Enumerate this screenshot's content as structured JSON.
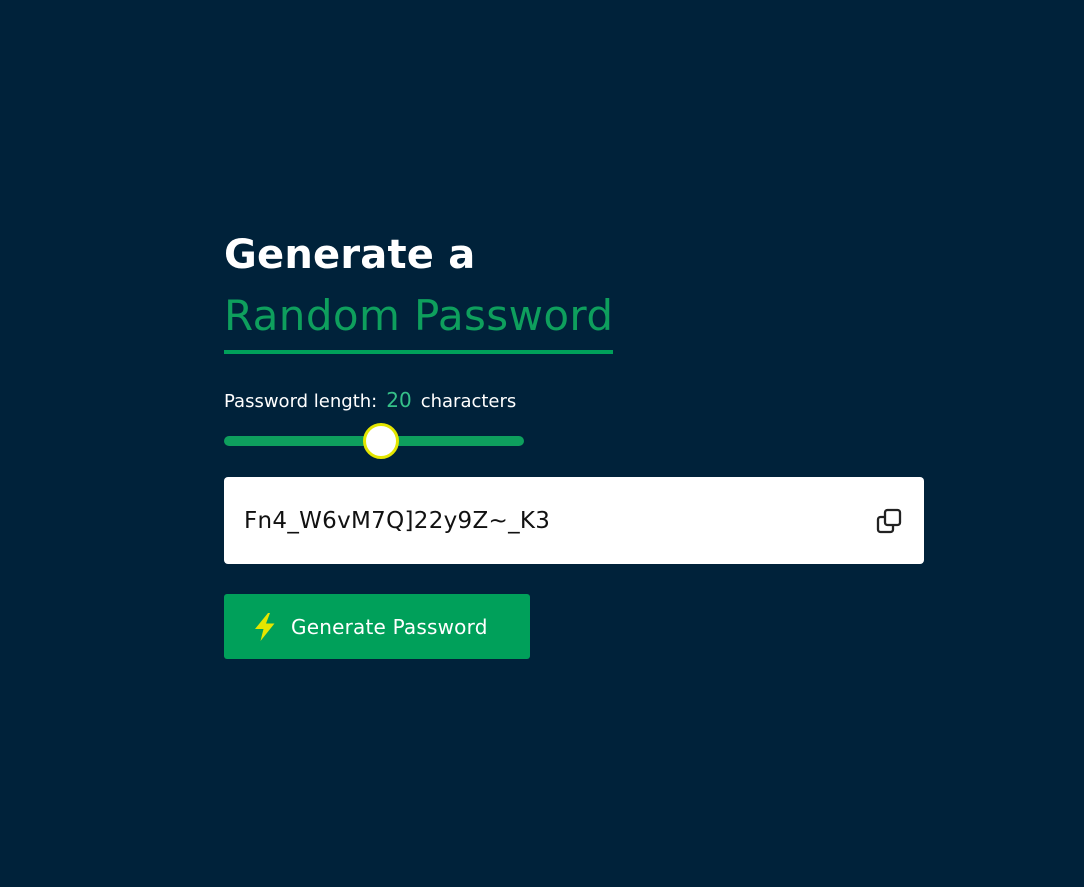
{
  "header": {
    "title_line1": "Generate a",
    "title_line2": "Random Password"
  },
  "length": {
    "label": "Password length:",
    "value": "20",
    "unit": "characters",
    "slider_fraction": 0.52
  },
  "password": {
    "value": "Fn4_W6vM7Q]22y9Z~_K3"
  },
  "icons": {
    "copy": "copy-icon",
    "generate": "lightning-bolt-icon"
  },
  "button": {
    "generate_label": "Generate Password"
  },
  "colors": {
    "background": "#00223a",
    "accent": "#0e9f5d",
    "length_value": "#35c189",
    "slider_thumb_ring": "#e4e600",
    "bolt": "#e4e600"
  }
}
